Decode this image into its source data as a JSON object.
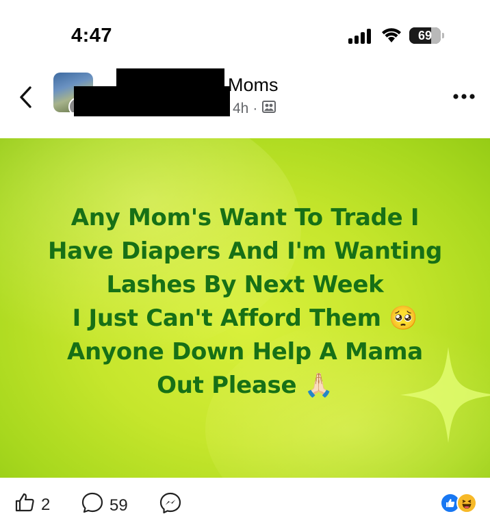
{
  "status_bar": {
    "time": "4:47",
    "battery": "69"
  },
  "post": {
    "group_name_visible": "Moms",
    "age": "4h",
    "separator": "·",
    "text_lines": [
      "Any Mom's Want To Trade I",
      "Have Diapers And I'm Wanting",
      "Lashes By Next Week",
      "I Just Can't Afford Them 🥺",
      "Anyone Down Help A Mama",
      "Out Please 🙏🏻"
    ],
    "background_colors": {
      "light": "#d9f03c",
      "dark": "#96cc16",
      "text": "#177016"
    }
  },
  "actions": {
    "likes": "2",
    "comments": "59"
  },
  "icons": {
    "back": "chevron-left-icon",
    "more": "more-icon",
    "privacy": "group-privacy-icon",
    "like": "thumbs-up-icon",
    "comment": "comment-icon",
    "messenger": "messenger-icon"
  },
  "battery_level": 0.69
}
